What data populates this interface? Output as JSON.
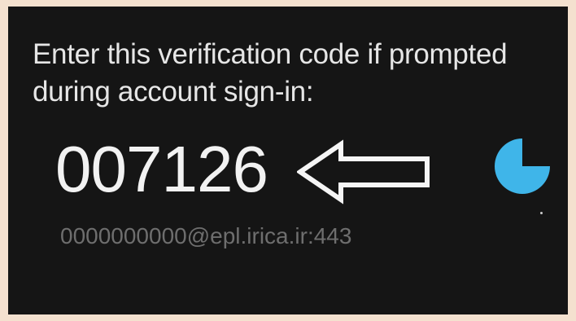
{
  "verification": {
    "prompt": "Enter this verification code if prompted during account sign-in:",
    "code": "007126",
    "account": "0000000000@epl.irica.ir:443",
    "timer_remaining_fraction": 0.75
  },
  "colors": {
    "background": "#151515",
    "text": "#e6e6e6",
    "account_text": "#6e6e6e",
    "timer": "#3fb5e9",
    "border": "#f4e1cf"
  },
  "icons": {
    "arrow": "left-arrow-icon",
    "timer": "countdown-timer-icon"
  }
}
